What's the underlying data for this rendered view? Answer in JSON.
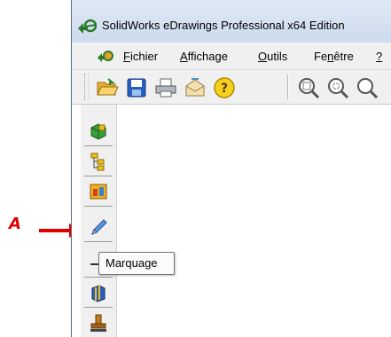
{
  "window": {
    "title": "SolidWorks eDrawings Professional x64 Edition"
  },
  "menu": {
    "items": [
      {
        "mnemonic": "F",
        "rest": "ichier"
      },
      {
        "mnemonic": "A",
        "rest": "ffichage"
      },
      {
        "mnemonic": "O",
        "rest": "utils"
      },
      {
        "prefix": "Fe",
        "mnemonic": "n",
        "rest": "être"
      },
      {
        "mnemonic": "?",
        "rest": ""
      }
    ]
  },
  "toolbar": {
    "buttons": [
      "open-icon",
      "save-icon",
      "print-icon",
      "email-icon",
      "help-icon",
      "zoom-to-fit-icon",
      "zoom-to-area-icon",
      "zoom-in-out-icon"
    ]
  },
  "sidebar": {
    "buttons": [
      "components-icon",
      "tree-icon",
      "configurations-icon",
      "markup-pencil-icon",
      "measure-icon",
      "section-icon",
      "stamp-icon"
    ],
    "tooltip": "Marquage"
  },
  "annotation": {
    "label": "A",
    "color": "#e00000"
  }
}
